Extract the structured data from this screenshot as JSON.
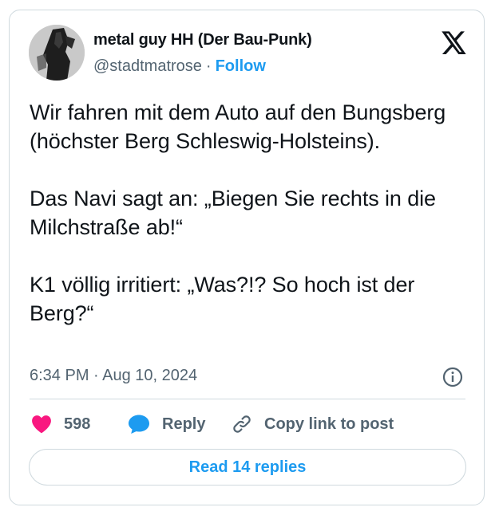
{
  "author": {
    "display_name": "metal guy HH (Der Bau-Punk)",
    "handle": "@stadtmatrose",
    "separator": "·",
    "follow_label": "Follow"
  },
  "icons": {
    "avatar": "avatar-image",
    "brand": "x-logo-icon",
    "info": "info-icon",
    "like": "heart-icon",
    "reply": "speech-bubble-icon",
    "copy": "link-icon"
  },
  "tweet": {
    "text": "Wir fahren mit dem Auto auf den Bungsberg (höchster Berg Schleswig-Holsteins).\n\nDas Navi sagt an: „Biegen Sie rechts in die Milchstraße ab!“\n\nK1 völlig irritiert: „Was?!? So hoch ist der Berg?“",
    "timestamp": "6:34 PM · Aug 10, 2024"
  },
  "actions": {
    "like_count": "598",
    "reply_label": "Reply",
    "copy_label": "Copy link to post"
  },
  "footer": {
    "read_replies_label": "Read 14 replies"
  },
  "colors": {
    "accent": "#1d9bf0",
    "like": "#f91880",
    "muted_text": "#536471",
    "border": "#cfd9de"
  }
}
